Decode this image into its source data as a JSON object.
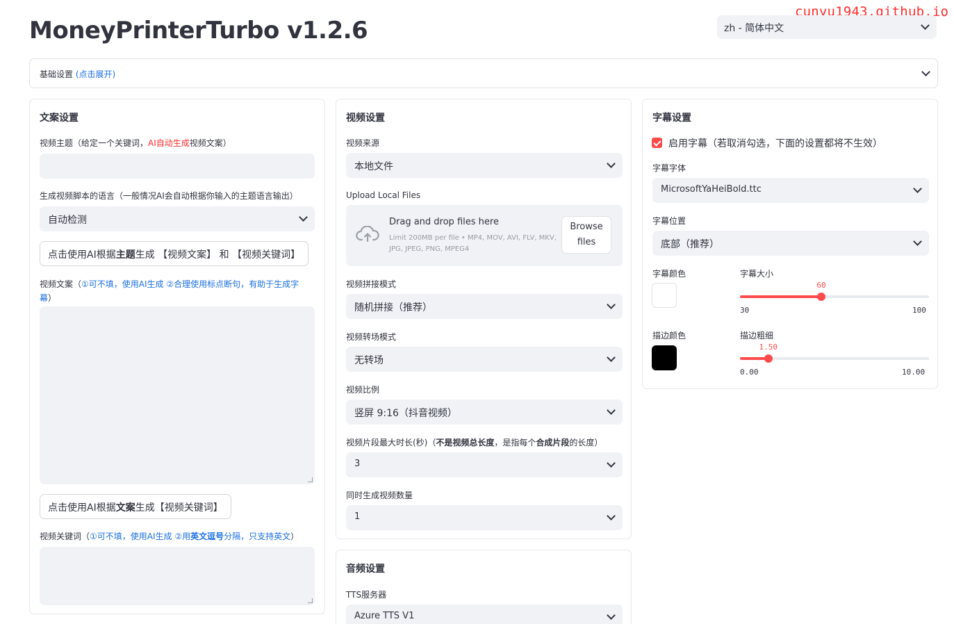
{
  "watermark": "cunyu1943.github.io",
  "app_title": "MoneyPrinterTurbo v1.2.6",
  "language_select": {
    "value": "zh - 简体中文"
  },
  "basic_settings": {
    "label": "基础设置",
    "hint": "(点击展开)"
  },
  "script_settings": {
    "title": "文案设置",
    "subject_label_pre": "视频主题（给定一个关键词，",
    "subject_label_ai": "AI自动生成",
    "subject_label_post": "视频文案）",
    "subject_value": "",
    "language_label": "生成视频脚本的语言（一般情况AI会自动根据你输入的主题语言输出）",
    "language_value": "自动检测",
    "gen_button_pre": "点击使用AI根据",
    "gen_button_bold": "主题",
    "gen_button_post": "生成 【视频文案】 和 【视频关键词】",
    "copy_label_pre": "视频文案（",
    "copy_label_hint": "①可不填，使用AI生成  ②合理使用标点断句，有助于生成字",
    "copy_label_hint2": "幕",
    "copy_label_post": "）",
    "copy_value": "",
    "kw_button_pre": "点击使用AI根据",
    "kw_button_bold": "文案",
    "kw_button_post": "生成【视频关键词】",
    "keywords_label_pre": "视频关键词（",
    "keywords_label_h1": "①可不填，使用AI生成 ②用",
    "keywords_label_b": "英文逗号",
    "keywords_label_h2": "分隔，只支持英文",
    "keywords_label_post": "）",
    "keywords_value": ""
  },
  "video_settings": {
    "title": "视频设置",
    "source_label": "视频来源",
    "source_value": "本地文件",
    "upload_label": "Upload Local Files",
    "upload_main": "Drag and drop files here",
    "upload_sub": "Limit 200MB per file • MP4, MOV, AVI, FLV, MKV, JPG, JPEG, PNG, MPEG4",
    "browse_line1": "Browse",
    "browse_line2": "files",
    "concat_label": "视频拼接模式",
    "concat_value": "随机拼接（推荐）",
    "transition_label": "视频转场模式",
    "transition_value": "无转场",
    "aspect_label": "视频比例",
    "aspect_value": "竖屏 9:16（抖音视频）",
    "clip_label_pre": "视频片段最大时长(秒)（",
    "clip_label_b1": "不是视频总长度",
    "clip_label_mid": "，是指每个",
    "clip_label_b2": "合成片段",
    "clip_label_post": "的长度）",
    "clip_value": "3",
    "count_label": "同时生成视频数量",
    "count_value": "1"
  },
  "audio_settings": {
    "title": "音频设置",
    "tts_label": "TTS服务器",
    "tts_value": "Azure TTS V1"
  },
  "subtitle_settings": {
    "title": "字幕设置",
    "enable_label": "启用字幕（若取消勾选，下面的设置都将不生效）",
    "font_label": "字幕字体",
    "font_value": "MicrosoftYaHeiBold.ttc",
    "position_label": "字幕位置",
    "position_value": "底部（推荐）",
    "color_label": "字幕颜色",
    "color_value": "#ffffff",
    "size_label": "字幕大小",
    "size_value": "60",
    "size_min": "30",
    "size_max": "100",
    "size_fraction": 0.43,
    "stroke_color_label": "描边颜色",
    "stroke_color_value": "#000000",
    "stroke_width_label": "描边粗细",
    "stroke_width_value": "1.50",
    "stroke_width_min": "0.00",
    "stroke_width_max": "10.00",
    "stroke_width_fraction": 0.15
  },
  "colors": {
    "accent": "#ff4b4b",
    "link": "#1c6fe0",
    "input_bg": "#f0f2f6"
  }
}
